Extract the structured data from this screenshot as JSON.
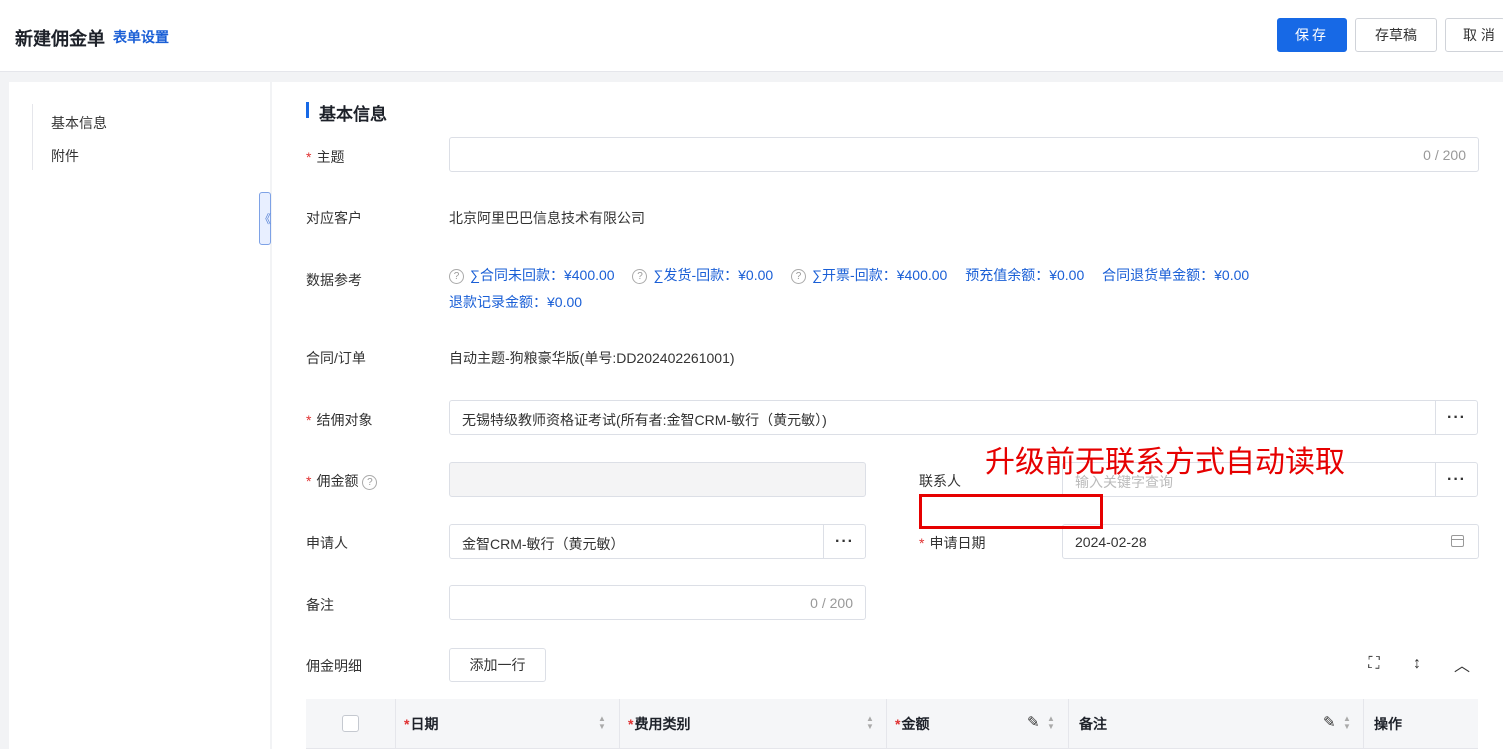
{
  "header": {
    "title": "新建佣金单",
    "form_settings": "表单设置",
    "save": "保存",
    "draft": "存草稿",
    "cancel": "取 消"
  },
  "sidenav": {
    "items": [
      {
        "label": "基本信息"
      },
      {
        "label": "附件"
      }
    ],
    "collapse_glyph": "《"
  },
  "section": {
    "title": "基本信息"
  },
  "form": {
    "subject": {
      "required_mark": "*",
      "label": "主题",
      "counter": "0 / 200"
    },
    "customer": {
      "label": "对应客户",
      "value": "北京阿里巴巴信息技术有限公司"
    },
    "data_ref": {
      "label": "数据参考",
      "help_glyph": "?",
      "items": [
        "∑合同未回款：¥400.00",
        "∑发货-回款：¥0.00",
        "∑开票-回款：¥400.00",
        "预充值余额：¥0.00",
        "合同退货单金额：¥0.00",
        "退款记录金额：¥0.00"
      ]
    },
    "contract": {
      "label": "合同/订单",
      "value": "自动主题-狗粮豪华版(单号:DD202402261001)"
    },
    "settle_target": {
      "required_mark": "*",
      "label": "结佣对象",
      "value": "无锡特级教师资格证考试(所有者:金智CRM-敏行（黄元敏）)",
      "more": "···"
    },
    "commission": {
      "required_mark": "*",
      "label": "佣金额",
      "help_glyph": "?"
    },
    "contact": {
      "label": "联系人",
      "placeholder": "输入关键字查询",
      "more": "···"
    },
    "applicant": {
      "label": "申请人",
      "value": "金智CRM-敏行（黄元敏）",
      "more": "···"
    },
    "apply_date": {
      "required_mark": "*",
      "label": "申请日期",
      "value": "2024-02-28"
    },
    "remark": {
      "label": "备注",
      "counter": "0 / 200"
    },
    "detail": {
      "label": "佣金明细",
      "add_row": "添加一行"
    }
  },
  "annotation": {
    "text": "升级前无联系方式自动读取",
    "color": "#e60000"
  },
  "table": {
    "required_mark": "*",
    "columns": [
      "日期",
      "费用类别",
      "金额",
      "备注",
      "操作"
    ],
    "sort_up": "▲",
    "sort_down": "▼",
    "edit_glyph": "✎"
  },
  "toolbar_icons": {
    "fullscreen": "⛶",
    "density": "↕",
    "collapse": "︿"
  },
  "colors": {
    "primary": "#1769e6",
    "link": "#1a5fd6",
    "required": "#e03131"
  }
}
